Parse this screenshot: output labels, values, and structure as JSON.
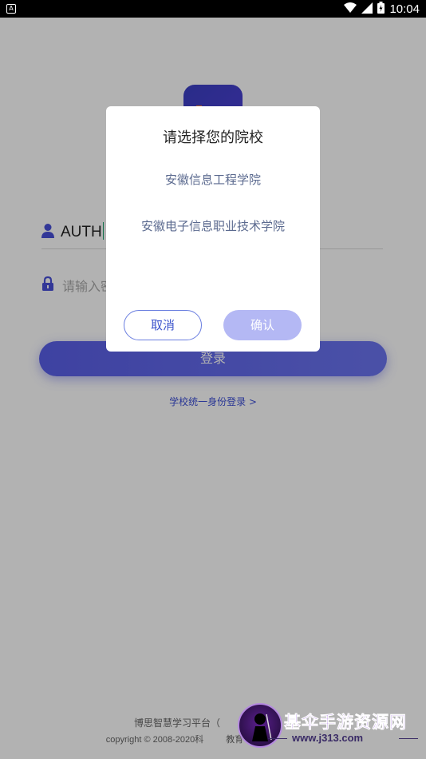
{
  "status_bar": {
    "app_icon": "A",
    "time": "10:04",
    "icons": [
      "wifi-icon",
      "signal-icon",
      "battery-icon"
    ]
  },
  "login": {
    "username_value": "AUTH",
    "password_placeholder": "请输入密码",
    "login_label": "登录",
    "sso_link": "学校统一身份登录 >",
    "footer_line1": "博思智慧学习平台（",
    "footer_line2_prefix": "copyright © 2008-2020",
    "footer_line2_suffix": "科",
    "footer_line2_tail": "教育"
  },
  "dialog": {
    "title": "请选择您的院校",
    "schools": [
      "安徽信息工程学院",
      "安徽电子信息职业技术学院"
    ],
    "cancel_label": "取消",
    "confirm_label": "确认"
  },
  "watermark": {
    "name": "基伞手游资源网",
    "url": "www.j313.com"
  },
  "colors": {
    "accent": "#5a5fe8",
    "dialog_text": "#5b6a8f",
    "confirm_disabled": "#b4b8f4",
    "cursor": "#1aa36b"
  }
}
